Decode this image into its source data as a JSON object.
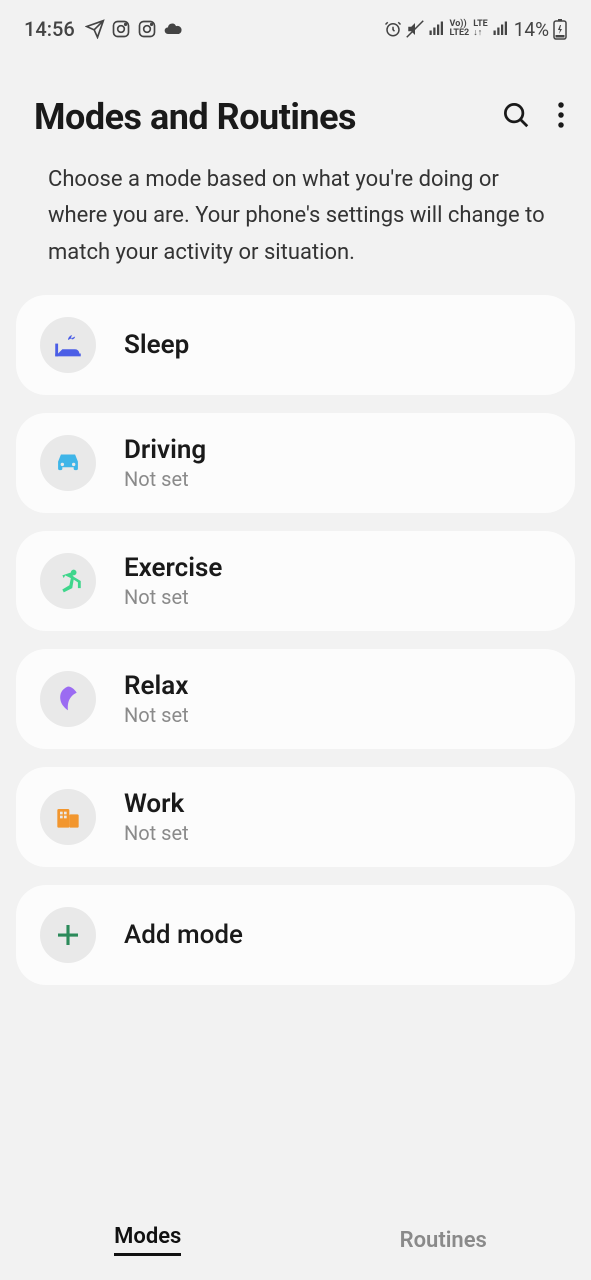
{
  "status": {
    "time": "14:56",
    "battery": "14%"
  },
  "header": {
    "title": "Modes and Routines"
  },
  "description": "Choose a mode based on what you're doing or where you are. Your phone's settings will change to match your activity or situation.",
  "modes": {
    "sleep": {
      "title": "Sleep"
    },
    "driving": {
      "title": "Driving",
      "sub": "Not set"
    },
    "exercise": {
      "title": "Exercise",
      "sub": "Not set"
    },
    "relax": {
      "title": "Relax",
      "sub": "Not set"
    },
    "work": {
      "title": "Work",
      "sub": "Not set"
    },
    "add": {
      "title": "Add mode"
    }
  },
  "tabs": {
    "modes": "Modes",
    "routines": "Routines"
  }
}
